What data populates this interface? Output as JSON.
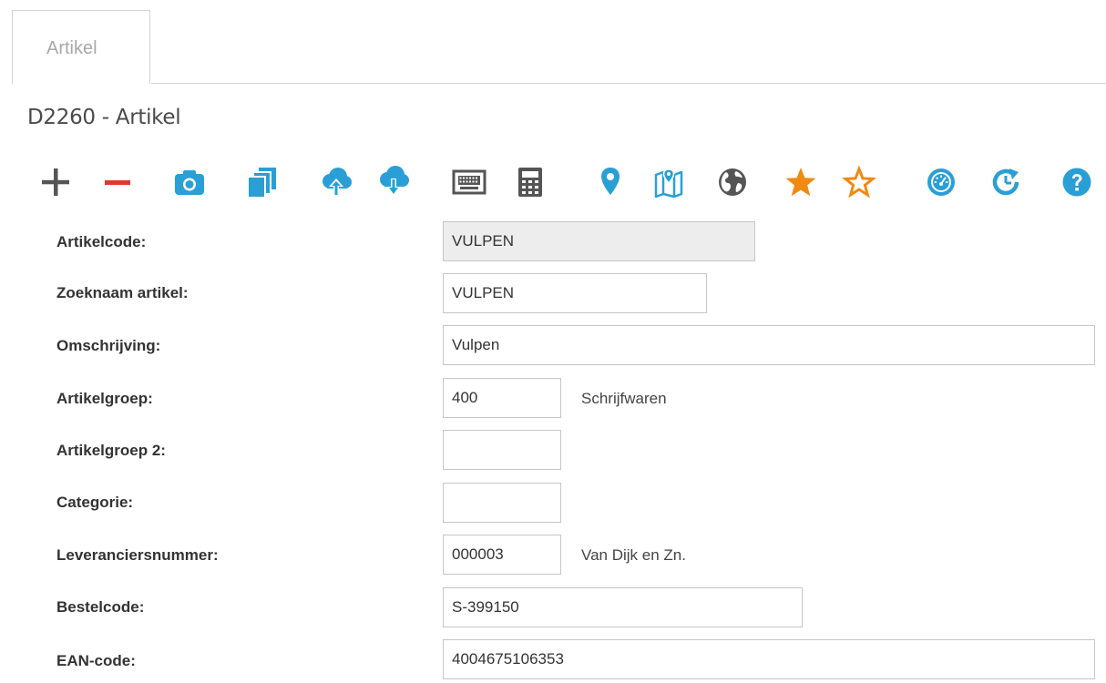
{
  "tabs": [
    {
      "label": "Artikel"
    }
  ],
  "page": {
    "title": "D2260 - Artikel"
  },
  "toolbar": {
    "icons": [
      "plus-icon",
      "minus-icon",
      "camera-icon",
      "copy-icon",
      "cloud-upload-icon",
      "cloud-download-icon",
      "keyboard-icon",
      "calculator-icon",
      "map-marker-icon",
      "map-icon",
      "globe-icon",
      "star-filled-icon",
      "star-outline-icon",
      "dashboard-icon",
      "refresh-clock-icon",
      "help-icon"
    ],
    "colors": {
      "blue": "#2a9fd6",
      "red": "#e0392a",
      "gray": "#555555",
      "orange": "#f08a12"
    }
  },
  "form": {
    "artikelcode": {
      "label": "Artikelcode:",
      "value": "VULPEN"
    },
    "zoeknaam": {
      "label": "Zoeknaam artikel:",
      "value": "VULPEN"
    },
    "omschrijving": {
      "label": "Omschrijving:",
      "value": "Vulpen"
    },
    "artikelgroep": {
      "label": "Artikelgroep:",
      "value": "400",
      "description": "Schrijfwaren"
    },
    "artikelgroep2": {
      "label": "Artikelgroep 2:",
      "value": ""
    },
    "categorie": {
      "label": "Categorie:",
      "value": ""
    },
    "leveranciersnummer": {
      "label": "Leveranciersnummer:",
      "value": "000003",
      "description": "Van Dijk en Zn."
    },
    "bestelcode": {
      "label": "Bestelcode:",
      "value": "S-399150"
    },
    "ean": {
      "label": "EAN-code:",
      "value": "4004675106353"
    }
  }
}
